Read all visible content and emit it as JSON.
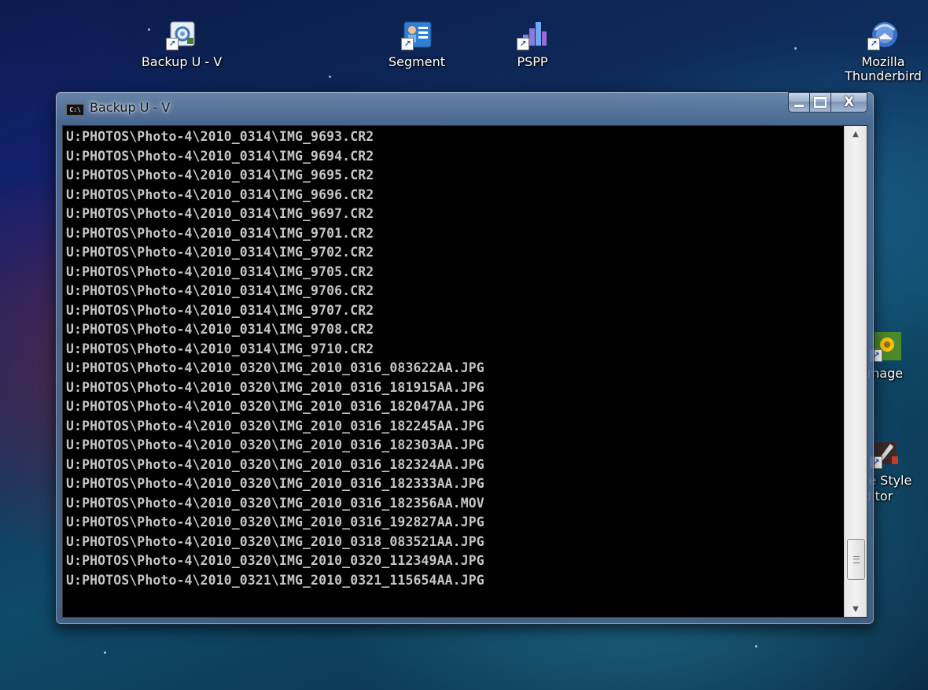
{
  "desktop": {
    "icons": [
      {
        "label": "Backup U - V",
        "icon": "backup-shortcut-icon"
      },
      {
        "label": "Segment",
        "icon": "segment-shortcut-icon"
      },
      {
        "label": "PSPP",
        "icon": "pspp-shortcut-icon"
      },
      {
        "label": "Mozilla",
        "label2": "Thunderbird",
        "icon": "thunderbird-shortcut-icon"
      },
      {
        "label": "Image",
        "icon": "image-shortcut-icon"
      },
      {
        "label": "re Style",
        "label2": "ditor",
        "icon": "style-editor-shortcut-icon"
      }
    ],
    "shortcut_arrow": "↗"
  },
  "window": {
    "title": "Backup U - V",
    "title_icon_text": "C:\\",
    "controls": {
      "close_symbol": "X"
    },
    "console_lines": [
      "U:PHOTOS\\Photo-4\\2010_0314\\IMG_9693.CR2",
      "U:PHOTOS\\Photo-4\\2010_0314\\IMG_9694.CR2",
      "U:PHOTOS\\Photo-4\\2010_0314\\IMG_9695.CR2",
      "U:PHOTOS\\Photo-4\\2010_0314\\IMG_9696.CR2",
      "U:PHOTOS\\Photo-4\\2010_0314\\IMG_9697.CR2",
      "U:PHOTOS\\Photo-4\\2010_0314\\IMG_9701.CR2",
      "U:PHOTOS\\Photo-4\\2010_0314\\IMG_9702.CR2",
      "U:PHOTOS\\Photo-4\\2010_0314\\IMG_9705.CR2",
      "U:PHOTOS\\Photo-4\\2010_0314\\IMG_9706.CR2",
      "U:PHOTOS\\Photo-4\\2010_0314\\IMG_9707.CR2",
      "U:PHOTOS\\Photo-4\\2010_0314\\IMG_9708.CR2",
      "U:PHOTOS\\Photo-4\\2010_0314\\IMG_9710.CR2",
      "U:PHOTOS\\Photo-4\\2010_0320\\IMG_2010_0316_083622AA.JPG",
      "U:PHOTOS\\Photo-4\\2010_0320\\IMG_2010_0316_181915AA.JPG",
      "U:PHOTOS\\Photo-4\\2010_0320\\IMG_2010_0316_182047AA.JPG",
      "U:PHOTOS\\Photo-4\\2010_0320\\IMG_2010_0316_182245AA.JPG",
      "U:PHOTOS\\Photo-4\\2010_0320\\IMG_2010_0316_182303AA.JPG",
      "U:PHOTOS\\Photo-4\\2010_0320\\IMG_2010_0316_182324AA.JPG",
      "U:PHOTOS\\Photo-4\\2010_0320\\IMG_2010_0316_182333AA.JPG",
      "U:PHOTOS\\Photo-4\\2010_0320\\IMG_2010_0316_182356AA.MOV",
      "U:PHOTOS\\Photo-4\\2010_0320\\IMG_2010_0316_192827AA.JPG",
      "U:PHOTOS\\Photo-4\\2010_0320\\IMG_2010_0318_083521AA.JPG",
      "U:PHOTOS\\Photo-4\\2010_0320\\IMG_2010_0320_112349AA.JPG",
      "U:PHOTOS\\Photo-4\\2010_0321\\IMG_2010_0321_115654AA.JPG"
    ],
    "scrollbar": {
      "up_arrow": "▲",
      "down_arrow": "▼",
      "position": 0.95
    }
  },
  "colors": {
    "console_bg": "#000000",
    "console_text": "#c6c6c6"
  }
}
